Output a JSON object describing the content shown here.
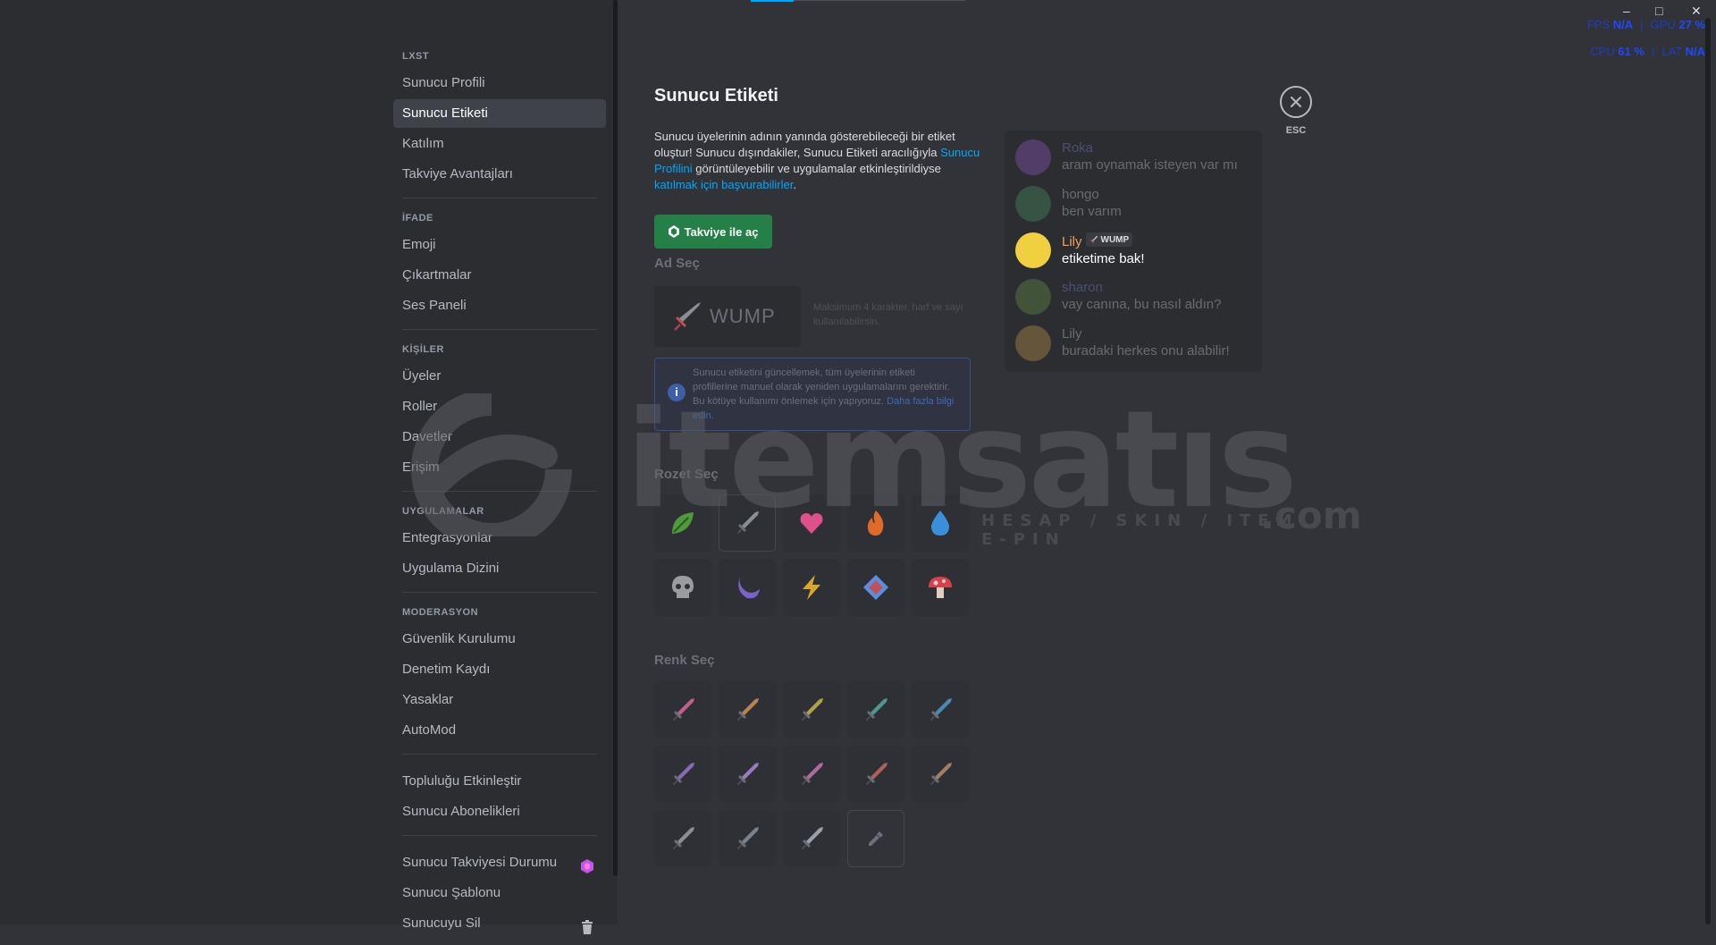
{
  "sidebar": {
    "sections": [
      {
        "header": "LXST",
        "items": [
          {
            "label": "Sunucu Profili"
          },
          {
            "label": "Sunucu Etiketi",
            "active": true
          },
          {
            "label": "Katılım"
          },
          {
            "label": "Takviye Avantajları"
          }
        ]
      },
      {
        "header": "İFADE",
        "items": [
          {
            "label": "Emoji"
          },
          {
            "label": "Çıkartmalar"
          },
          {
            "label": "Ses Paneli"
          }
        ]
      },
      {
        "header": "KİŞİLER",
        "items": [
          {
            "label": "Üyeler"
          },
          {
            "label": "Roller"
          },
          {
            "label": "Davetler"
          },
          {
            "label": "Erişim"
          }
        ]
      },
      {
        "header": "UYGULAMALAR",
        "items": [
          {
            "label": "Entegrasyonlar"
          },
          {
            "label": "Uygulama Dizini"
          }
        ]
      },
      {
        "header": "MODERASYON",
        "items": [
          {
            "label": "Güvenlik Kurulumu"
          },
          {
            "label": "Denetim Kaydı"
          },
          {
            "label": "Yasaklar"
          },
          {
            "label": "AutoMod"
          }
        ]
      },
      {
        "header": "",
        "items": [
          {
            "label": "Topluluğu Etkinleştir"
          },
          {
            "label": "Sunucu Abonelikleri"
          }
        ]
      },
      {
        "header": "",
        "items": [
          {
            "label": "Sunucu Takviyesi Durumu",
            "icon": "boost-gem-icon"
          },
          {
            "label": "Sunucu Şablonu"
          },
          {
            "label": "Sunucuyu Sil",
            "icon": "trash-icon"
          }
        ]
      }
    ]
  },
  "main": {
    "title": "Sunucu Etiketi",
    "desc_1": "Sunucu üyelerinin adının yanında gösterebileceği bir etiket oluştur! Sunucu dışındakiler, Sunucu Etiketi aracılığıyla ",
    "desc_link_1": "Sunucu Profilini",
    "desc_2": " görüntüleyebilir ve uygulamalar etkinleştirildiyse ",
    "desc_link_2": "katılmak için başvurabilirler",
    "desc_3": ".",
    "boost_button": "Takviye ile aç",
    "name_label": "Ad Seç",
    "name_value": "WUMP",
    "name_hint": "Maksimum 4 karakter, harf ve sayı kullanılabilirsin.",
    "info_text": "Sunucu etiketini güncellemek, tüm üyelerinin etiketi profillerine manuel olarak yeniden uygulamalarını gerektirir. Bu kötüye kullanımı önlemek için yapıyoruz.",
    "info_link": "Daha fazla bilgi edin.",
    "badge_label": "Rozet Seç",
    "color_label": "Renk Seç"
  },
  "badges": [
    {
      "name": "leaf-badge-icon",
      "color": "#4f9a3c"
    },
    {
      "name": "sword-badge-icon",
      "color": "#8a8f96",
      "selected": true
    },
    {
      "name": "heart-badge-icon",
      "color": "#e0508a"
    },
    {
      "name": "fire-badge-icon",
      "color": "#e06a2a"
    },
    {
      "name": "water-drop-badge-icon",
      "color": "#3a8fd8"
    },
    {
      "name": "skull-badge-icon",
      "color": "#9a9ca0"
    },
    {
      "name": "moon-badge-icon",
      "color": "#7a62c8"
    },
    {
      "name": "lightning-badge-icon",
      "color": "#d8a82a"
    },
    {
      "name": "gem-badge-icon",
      "color": "#5a8ee0"
    },
    {
      "name": "mushroom-badge-icon",
      "color": "#d8404a"
    }
  ],
  "colors": [
    {
      "name": "color-pink-sword-icon",
      "color": "#c0608a"
    },
    {
      "name": "color-orange-sword-icon",
      "color": "#c0804a"
    },
    {
      "name": "color-yellow-sword-icon",
      "color": "#b0a04a"
    },
    {
      "name": "color-teal-sword-icon",
      "color": "#4a9a94"
    },
    {
      "name": "color-blue-sword-icon",
      "color": "#4a8ab0"
    },
    {
      "name": "color-purple-sword-icon",
      "color": "#8a6ab8"
    },
    {
      "name": "color-lavender-sword-icon",
      "color": "#9a7ac0"
    },
    {
      "name": "color-magenta-sword-icon",
      "color": "#b06aa0"
    },
    {
      "name": "color-red-sword-icon",
      "color": "#b0605a"
    },
    {
      "name": "color-brown-sword-icon",
      "color": "#a08060"
    },
    {
      "name": "color-gray-sword-icon",
      "color": "#8a8f96"
    },
    {
      "name": "color-slate-sword-icon",
      "color": "#7a8290"
    },
    {
      "name": "color-silver-sword-icon",
      "color": "#9aa0a8"
    },
    {
      "name": "eyedropper-icon",
      "color": "#6d6f78"
    }
  ],
  "preview": [
    {
      "name": "Roka",
      "text": "aram oynamak isteyen var mı",
      "name_color": "#8a8de8",
      "avatar": "#9a5ad0",
      "dim": true
    },
    {
      "name": "hongo",
      "text": "ben varım",
      "name_color": "#dbdee1",
      "avatar": "#4a9a6a",
      "dim": true
    },
    {
      "name": "Lily",
      "text": "etiketime bak!",
      "name_color": "#f0a060",
      "avatar": "#f0d040",
      "dim": false,
      "tag": "WUMP"
    },
    {
      "name": "sharon",
      "text": "vay canına, bu nasıl aldın?",
      "name_color": "#8a8de8",
      "avatar": "#6a9a4a",
      "dim": true
    },
    {
      "name": "Lily",
      "text": "buradaki herkes onu alabilir!",
      "name_color": "#dbdee1",
      "avatar": "#d0a050",
      "dim": true
    }
  ],
  "close": {
    "label": "ESC"
  },
  "overlay": {
    "fps_label": "FPS",
    "fps_value": "N/A",
    "gpu_label": "GPU",
    "gpu_value": "27 %",
    "cpu_label": "CPU",
    "cpu_value": "61 %",
    "lat_label": "LAT",
    "lat_value": "N/A"
  },
  "window": {
    "minimize": "–",
    "maximize": "□",
    "close": "✕"
  },
  "watermark": {
    "word": "itemsatıs",
    "sub": "HESAP / SKIN / ITEM / E-PIN",
    "com": ".com"
  }
}
